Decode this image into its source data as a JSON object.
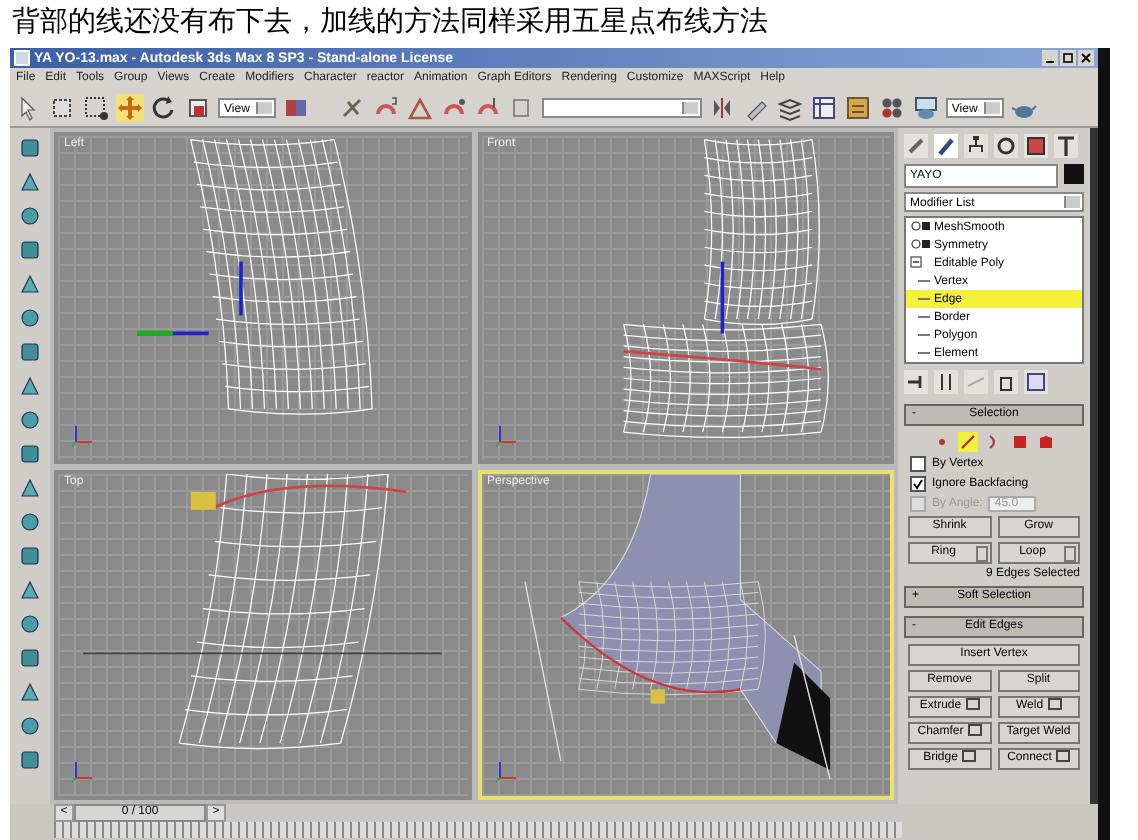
{
  "caption": "背部的线还没有布下去，加线的方法同样采用五星点布线方法",
  "window": {
    "title": "YA YO-13.max - Autodesk 3ds Max 8 SP3 - Stand-alone License"
  },
  "menu": [
    "File",
    "Edit",
    "Tools",
    "Group",
    "Views",
    "Create",
    "Modifiers",
    "Character",
    "reactor",
    "Animation",
    "Graph Editors",
    "Rendering",
    "Customize",
    "MAXScript",
    "Help"
  ],
  "toolbar": {
    "move_selected": true,
    "dropdowns": [
      "View",
      "View"
    ]
  },
  "viewports": [
    {
      "label": "Left",
      "kind": "side",
      "selected": false
    },
    {
      "label": "Front",
      "kind": "front",
      "selected": false
    },
    {
      "label": "Top",
      "kind": "top",
      "selected": false
    },
    {
      "label": "Perspective",
      "kind": "persp",
      "selected": true
    }
  ],
  "panel": {
    "object_name": "YAYO",
    "modifier_list": "Modifier List",
    "stack": [
      {
        "label": "MeshSmooth",
        "kind": "modifier",
        "selected": false
      },
      {
        "label": "Symmetry",
        "kind": "modifier",
        "selected": false
      },
      {
        "label": "Editable Poly",
        "kind": "object",
        "selected": false
      },
      {
        "label": "Vertex",
        "kind": "sub",
        "selected": false
      },
      {
        "label": "Edge",
        "kind": "sub",
        "selected": true
      },
      {
        "label": "Border",
        "kind": "sub",
        "selected": false
      },
      {
        "label": "Polygon",
        "kind": "sub",
        "selected": false
      },
      {
        "label": "Element",
        "kind": "sub",
        "selected": false
      }
    ],
    "selection": {
      "sign": "-",
      "title": "Selection",
      "modes": [
        {
          "selected": false
        },
        {
          "selected": true
        },
        {
          "selected": false
        },
        {
          "selected": false
        },
        {
          "selected": false
        }
      ],
      "options": [
        {
          "label": "By Vertex",
          "checked": false,
          "disabled": false
        },
        {
          "label": "Ignore Backfacing",
          "checked": true,
          "disabled": false
        },
        {
          "label": "By Angle:",
          "checked": false,
          "disabled": true,
          "value": "45.0"
        }
      ],
      "buttons": [
        "Shrink",
        "Grow"
      ],
      "spin_buttons": [
        "Ring",
        "Loop"
      ],
      "status": "9 Edges Selected"
    },
    "rollouts": [
      {
        "sign": "+",
        "title": "Soft Selection"
      },
      {
        "sign": "-",
        "title": "Edit Edges"
      }
    ],
    "edit_buttons": [
      {
        "label": "Insert Vertex",
        "settings": false,
        "wide": true
      },
      {
        "label": "Remove",
        "settings": false,
        "wide": false
      },
      {
        "label": "Split",
        "settings": false,
        "wide": false
      },
      {
        "label": "Extrude",
        "settings": true,
        "wide": false
      },
      {
        "label": "Weld",
        "settings": true,
        "wide": false
      },
      {
        "label": "Chamfer",
        "settings": true,
        "wide": false
      },
      {
        "label": "Target Weld",
        "settings": false,
        "wide": false
      },
      {
        "label": "Bridge",
        "settings": true,
        "wide": false
      },
      {
        "label": "Connect",
        "settings": true,
        "wide": false
      }
    ]
  },
  "timeline": {
    "frame": "0 / 100",
    "prev": "<",
    "next": ">",
    "level": 0
  }
}
